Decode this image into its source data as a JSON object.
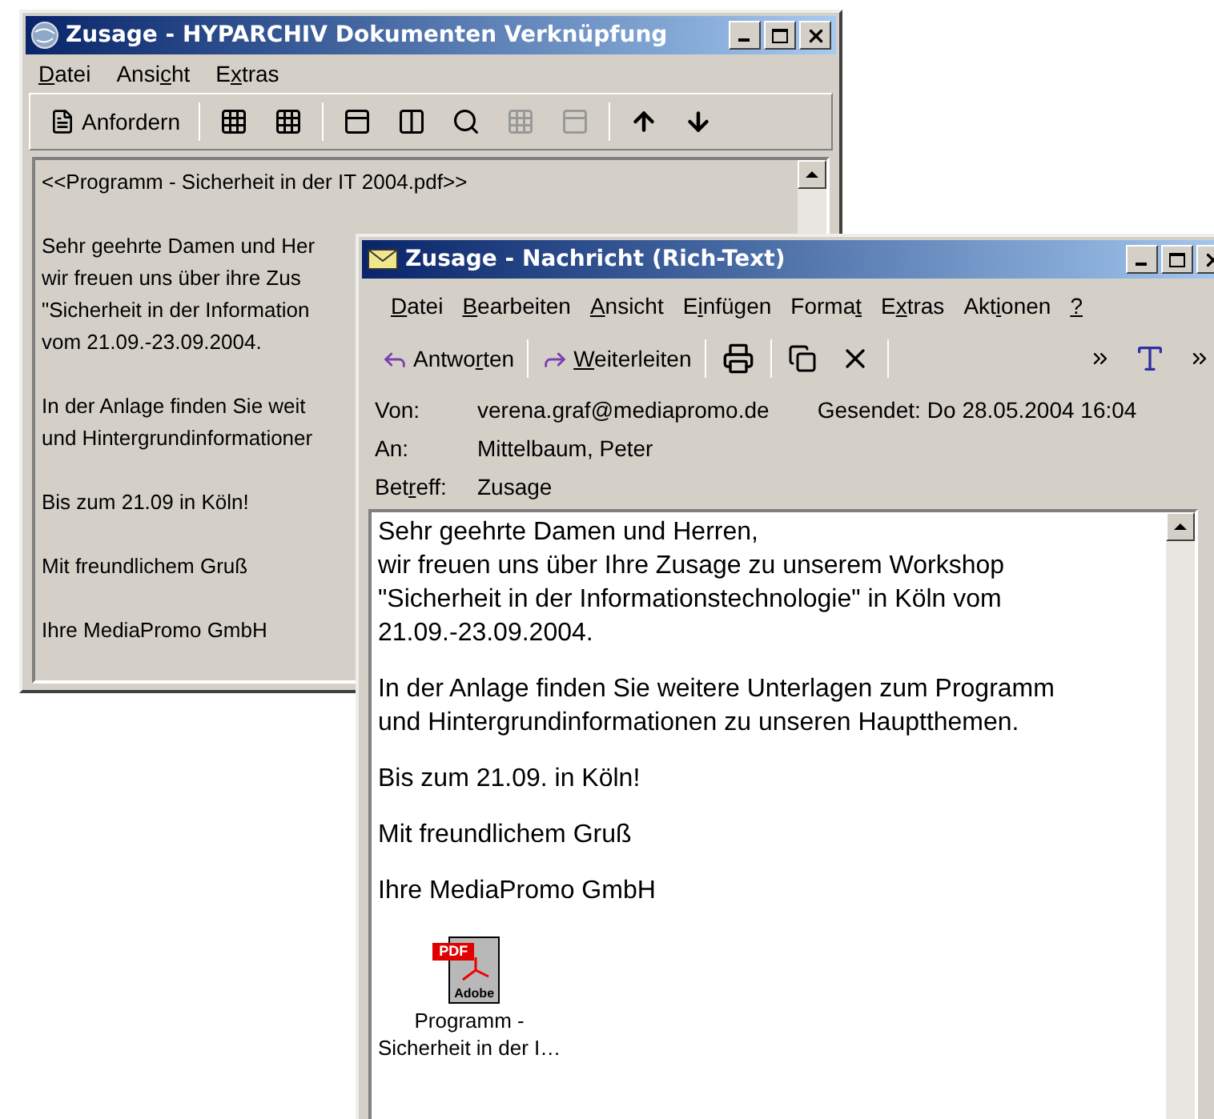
{
  "back_window": {
    "title": "Zusage - HYPARCHIV Dokumenten Verknüpfung",
    "menu": [
      {
        "key": "D",
        "after": "atei"
      },
      {
        "before": "Ansi",
        "key": "c",
        "after": "ht"
      },
      {
        "before": "E",
        "key": "x",
        "after": "tras"
      }
    ],
    "toolbar": {
      "request_button": "Anfordern"
    },
    "document": {
      "attachment_line": "<<Programm - Sicherheit in der IT 2004.pdf>>",
      "paragraphs": [
        [
          "Sehr geehrte Damen und Her",
          "wir freuen uns über ihre Zus",
          "\"Sicherheit in der Information",
          "vom 21.09.-23.09.2004."
        ],
        [
          "In der Anlage finden Sie weit",
          "und Hintergrundinformationer"
        ],
        [
          "Bis zum 21.09 in Köln!"
        ],
        [
          "Mit freundlichem Gruß"
        ],
        [
          "Ihre MediaPromo GmbH"
        ]
      ]
    }
  },
  "front_window": {
    "title": "Zusage - Nachricht (Rich-Text)",
    "menu": [
      {
        "key": "D",
        "after": "atei"
      },
      {
        "key": "B",
        "after": "earbeiten"
      },
      {
        "key": "A",
        "after": "nsicht"
      },
      {
        "before": "E",
        "key": "i",
        "after": "nfügen"
      },
      {
        "before": "Forma",
        "key": "t"
      },
      {
        "before": "E",
        "key": "x",
        "after": "tras"
      },
      {
        "before": "Akt",
        "key": "i",
        "after": "onen"
      },
      {
        "key": "?"
      }
    ],
    "toolbar": [
      {
        "kind": "reply",
        "before": "Antwo",
        "key": "r",
        "after": "ten"
      },
      {
        "kind": "forward",
        "key": "W",
        "after": "eiterleiten"
      }
    ],
    "header": [
      {
        "label": {
          "before": "Von:"
        },
        "value": "verena.graf@mediapromo.de"
      },
      {
        "label": {
          "before": "An:"
        },
        "value": "Mittelbaum, Peter"
      },
      {
        "label": {
          "before": "Bet",
          "key": "r",
          "after": "eff:"
        },
        "value": "Zusage"
      }
    ],
    "sent": {
      "label": "Gesendet:",
      "value": "Do 28.05.2004 16:04"
    },
    "body": [
      [
        "Sehr geehrte Damen und Herren,",
        "wir freuen uns über Ihre Zusage zu unserem Workshop",
        "\"Sicherheit in der Informationstechnologie\" in Köln vom",
        "21.09.-23.09.2004."
      ],
      [
        "In der Anlage finden Sie weitere Unterlagen zum Programm",
        "und Hintergrundinformationen zu unseren Hauptthemen."
      ],
      [
        "Bis zum 21.09. in Köln!"
      ],
      [
        "Mit freundlichem Gruß"
      ],
      [
        "Ihre MediaPromo GmbH"
      ]
    ],
    "attachment": {
      "badge": "PDF",
      "brand": "Adobe",
      "name_lines": [
        "Programm -",
        "Sicherheit in der I…"
      ]
    }
  }
}
